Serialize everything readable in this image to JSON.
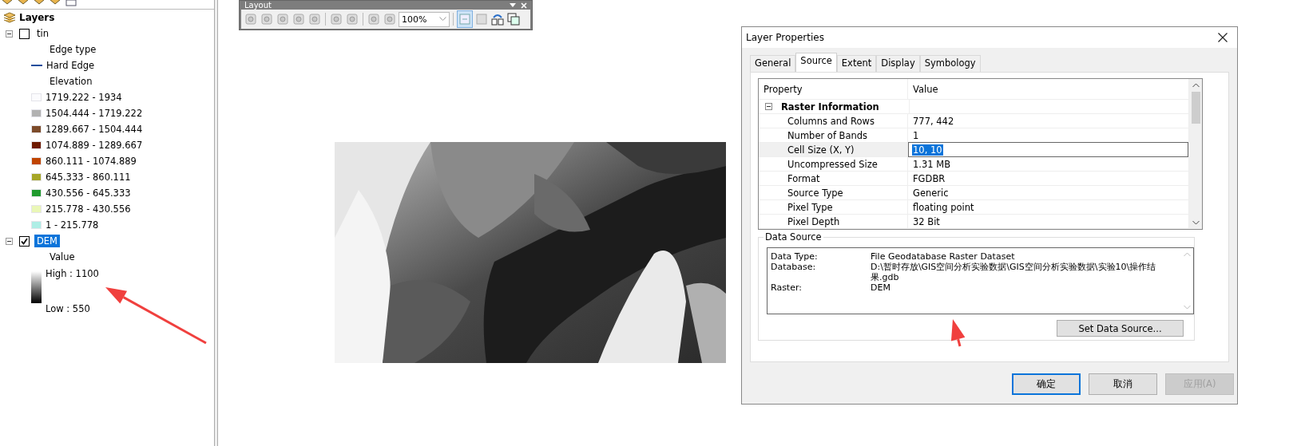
{
  "toc": {
    "title": "Layers",
    "layers": [
      {
        "name": "tin",
        "checked": false,
        "expanded": true,
        "selected": false,
        "legend": [
          {
            "kind": "heading",
            "label": "Edge type"
          },
          {
            "kind": "line",
            "label": "Hard Edge",
            "color": "#1f4e9c"
          },
          {
            "kind": "heading",
            "label": "Elevation"
          },
          {
            "kind": "swatch",
            "label": "1719.222 - 1934",
            "color": "#fbfbfd"
          },
          {
            "kind": "swatch",
            "label": "1504.444 - 1719.222",
            "color": "#b2b2b2"
          },
          {
            "kind": "swatch",
            "label": "1289.667 - 1504.444",
            "color": "#7d4b2a"
          },
          {
            "kind": "swatch",
            "label": "1074.889 - 1289.667",
            "color": "#6e1a00"
          },
          {
            "kind": "swatch",
            "label": "860.111 - 1074.889",
            "color": "#c04400"
          },
          {
            "kind": "swatch",
            "label": "645.333 - 860.111",
            "color": "#a6a627"
          },
          {
            "kind": "swatch",
            "label": "430.556 - 645.333",
            "color": "#1f9b2e"
          },
          {
            "kind": "swatch",
            "label": "215.778 - 430.556",
            "color": "#eaf7b7"
          },
          {
            "kind": "swatch",
            "label": "1 - 215.778",
            "color": "#aeeee6"
          }
        ]
      },
      {
        "name": "DEM",
        "checked": true,
        "expanded": true,
        "selected": true,
        "legend": [
          {
            "kind": "heading",
            "label": "Value"
          },
          {
            "kind": "ramp",
            "high": "High : 1100",
            "low": "Low : 550"
          }
        ]
      }
    ]
  },
  "layout_toolbar": {
    "title": "Layout",
    "zoom": "100%"
  },
  "dialog": {
    "title": "Layer Properties",
    "tabs": [
      {
        "label": "General",
        "selected": false
      },
      {
        "label": "Source",
        "selected": true
      },
      {
        "label": "Extent",
        "selected": false
      },
      {
        "label": "Display",
        "selected": false
      },
      {
        "label": "Symbology",
        "selected": false
      }
    ],
    "grid": {
      "columns": [
        "Property",
        "Value"
      ],
      "group": {
        "label": "Raster Information",
        "expanded": true
      },
      "rows": [
        {
          "property": "Columns and Rows",
          "value": "777, 442",
          "selected": false
        },
        {
          "property": "Number of Bands",
          "value": "1",
          "selected": false
        },
        {
          "property": "Cell Size (X, Y)",
          "value": "10, 10",
          "selected": true
        },
        {
          "property": "Uncompressed Size",
          "value": "1.31 MB",
          "selected": false
        },
        {
          "property": "Format",
          "value": "FGDBR",
          "selected": false
        },
        {
          "property": "Source Type",
          "value": "Generic",
          "selected": false
        },
        {
          "property": "Pixel Type",
          "value": "floating point",
          "selected": false
        },
        {
          "property": "Pixel Depth",
          "value": "32 Bit",
          "selected": false
        }
      ]
    },
    "data_source": {
      "title": "Data Source",
      "rows": [
        {
          "label": "Data Type:",
          "value": "File Geodatabase Raster Dataset"
        },
        {
          "label": "Database:",
          "value": "D:\\暂时存放\\GIS空间分析实验数据\\GIS空间分析实验数据\\实验10\\操作结果.gdb"
        },
        {
          "label": "Raster:",
          "value": "DEM"
        }
      ],
      "button": "Set Data Source..."
    },
    "buttons": [
      {
        "label": "确定",
        "default": true,
        "disabled": false
      },
      {
        "label": "取消",
        "default": false,
        "disabled": false
      },
      {
        "label": "应用(A)",
        "default": false,
        "disabled": true
      }
    ]
  }
}
